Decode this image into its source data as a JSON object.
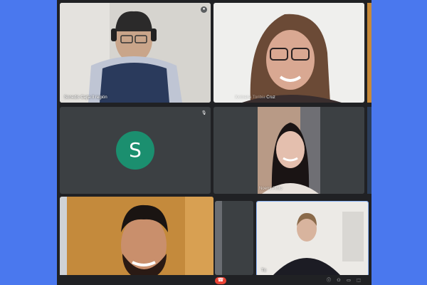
{
  "meeting": {
    "participants": [
      {
        "name": "Sonedis Cajta II región",
        "type": "video"
      },
      {
        "name": "Cruz",
        "name_prefix_obscured": "Xximena Toribia",
        "type": "video"
      },
      {
        "name": "",
        "initial": "S",
        "type": "avatar"
      },
      {
        "name": "Noemi Pinto",
        "type": "video"
      },
      {
        "name": "",
        "type": "video"
      },
      {
        "name": "Tú",
        "type": "video"
      }
    ],
    "colors": {
      "page_bg": "#4a78ee",
      "meet_bg": "#202124",
      "tile_bg": "#3c4043",
      "avatar_bg": "#1b8f6f",
      "end_call": "#ea4335"
    }
  },
  "controls": {
    "mic_icon": "mic-off-icon",
    "end_call_icon": "end-call-icon"
  }
}
